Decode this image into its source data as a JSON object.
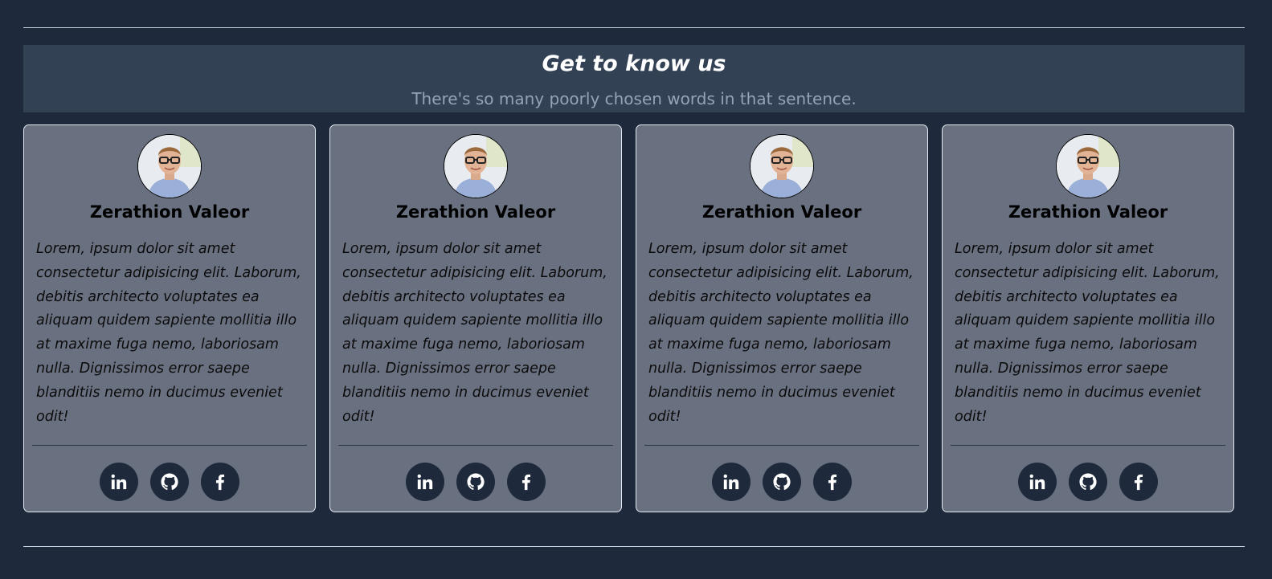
{
  "header": {
    "title": "Get to know us",
    "subtitle": "There's so many poorly chosen words in that sentence."
  },
  "members": [
    {
      "name": "Zerathion Valeor",
      "bio": "Lorem, ipsum dolor sit amet consectetur adipisicing elit. Laborum, debitis architecto voluptates ea aliquam quidem sapiente mollitia illo at maxime fuga nemo, laboriosam nulla. Dignissimos error saepe blanditiis nemo in ducimus eveniet odit!"
    },
    {
      "name": "Zerathion Valeor",
      "bio": "Lorem, ipsum dolor sit amet consectetur adipisicing elit. Laborum, debitis architecto voluptates ea aliquam quidem sapiente mollitia illo at maxime fuga nemo, laboriosam nulla. Dignissimos error saepe blanditiis nemo in ducimus eveniet odit!"
    },
    {
      "name": "Zerathion Valeor",
      "bio": "Lorem, ipsum dolor sit amet consectetur adipisicing elit. Laborum, debitis architecto voluptates ea aliquam quidem sapiente mollitia illo at maxime fuga nemo, laboriosam nulla. Dignissimos error saepe blanditiis nemo in ducimus eveniet odit!"
    },
    {
      "name": "Zerathion Valeor",
      "bio": "Lorem, ipsum dolor sit amet consectetur adipisicing elit. Laborum, debitis architecto voluptates ea aliquam quidem sapiente mollitia illo at maxime fuga nemo, laboriosam nulla. Dignissimos error saepe blanditiis nemo in ducimus eveniet odit!"
    }
  ],
  "social_icons": [
    "linkedin-icon",
    "github-icon",
    "facebook-icon"
  ],
  "colors": {
    "background": "#1e293b",
    "header_band": "#334155",
    "card": "#697080",
    "icon_circle": "#1e293b"
  }
}
